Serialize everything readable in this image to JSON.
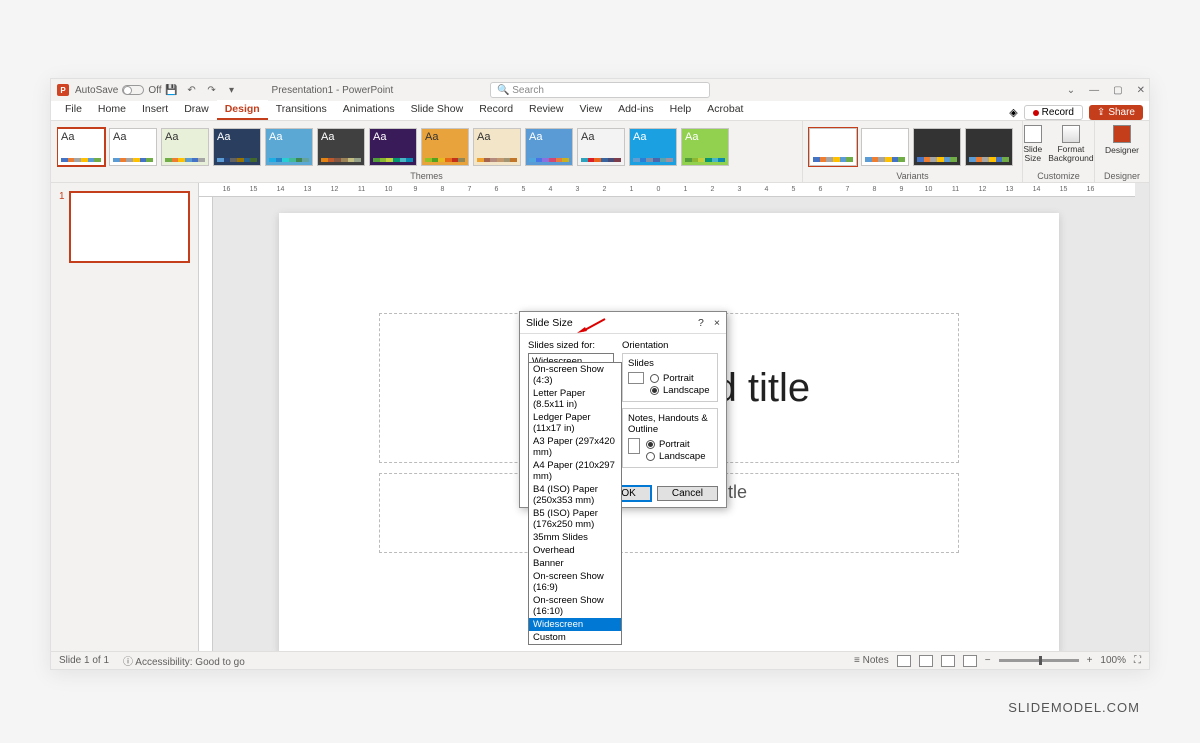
{
  "titlebar": {
    "autosave_label": "AutoSave",
    "autosave_state": "Off",
    "doc_title": "Presentation1 - PowerPoint",
    "search_placeholder": "Search"
  },
  "menu": {
    "tabs": [
      "File",
      "Home",
      "Insert",
      "Draw",
      "Design",
      "Transitions",
      "Animations",
      "Slide Show",
      "Record",
      "Review",
      "View",
      "Add-ins",
      "Help",
      "Acrobat"
    ],
    "active": "Design",
    "record_btn": "Record",
    "share_btn": "Share"
  },
  "ribbon": {
    "themes_label": "Themes",
    "variants_label": "Variants",
    "customize_label": "Customize",
    "designer_label": "Designer",
    "slide_size_btn": "Slide\nSize",
    "format_bg_btn": "Format\nBackground",
    "designer_btn": "Designer",
    "theme_colors": [
      [
        "#4472c4",
        "#ed7d31",
        "#a5a5a5",
        "#ffc000",
        "#5b9bd5",
        "#70ad47"
      ],
      [
        "#5b9bd5",
        "#ed7d31",
        "#a5a5a5",
        "#ffc000",
        "#4472c4",
        "#70ad47"
      ],
      [
        "#70ad47",
        "#ed7d31",
        "#ffc000",
        "#5b9bd5",
        "#4472c4",
        "#a5a5a5"
      ],
      [
        "#5b9bd5",
        "#264478",
        "#636363",
        "#997300",
        "#255e91",
        "#43682b"
      ],
      [
        "#1cade4",
        "#2683c6",
        "#27ced7",
        "#42ba97",
        "#3e8853",
        "#62a39f"
      ],
      [
        "#e48312",
        "#bd582c",
        "#865640",
        "#9b8357",
        "#c2bc80",
        "#94a088"
      ],
      [
        "#549e39",
        "#8ab833",
        "#c0cf3a",
        "#029676",
        "#4ab5c4",
        "#0989b1"
      ],
      [
        "#90c226",
        "#54a021",
        "#e6b91e",
        "#e76618",
        "#c42f1a",
        "#918655"
      ],
      [
        "#f0a22e",
        "#a5644e",
        "#b58b80",
        "#c3986d",
        "#a19574",
        "#c17529"
      ],
      [
        "#4ea6dc",
        "#4775e7",
        "#8971e1",
        "#d54773",
        "#e87b3e",
        "#c9b01f"
      ],
      [
        "#2da2bf",
        "#da1f28",
        "#eb641b",
        "#39639d",
        "#474b78",
        "#7d3c4a"
      ],
      [
        "#629dd1",
        "#297fd5",
        "#7f8fa9",
        "#4a66ac",
        "#5aa2ae",
        "#9d90a0"
      ],
      [
        "#549e39",
        "#8ab833",
        "#c0cf3a",
        "#029676",
        "#4ab5c4",
        "#0989b1"
      ]
    ],
    "theme_bg": [
      "#fff",
      "#fff",
      "#e8f0da",
      "#2a3f5f",
      "#5ba8d4",
      "#404040",
      "#3a1b5a",
      "#e8a33d",
      "#f3e6c8",
      "#5b9bd5",
      "#f3f3f3",
      "#1ba1e2",
      "#92d050"
    ],
    "theme_text_color": [
      "#333",
      "#333",
      "#333",
      "#fff",
      "#fff",
      "#fff",
      "#fff",
      "#333",
      "#333",
      "#fff",
      "#333",
      "#fff",
      "#fff"
    ],
    "variant_bg": [
      "#fff",
      "#fff",
      "#333",
      "#333"
    ],
    "variant_colors": [
      [
        "#4472c4",
        "#ed7d31",
        "#a5a5a5",
        "#ffc000",
        "#5b9bd5",
        "#70ad47"
      ],
      [
        "#5b9bd5",
        "#ed7d31",
        "#a5a5a5",
        "#ffc000",
        "#4472c4",
        "#70ad47"
      ],
      [
        "#4472c4",
        "#ed7d31",
        "#a5a5a5",
        "#ffc000",
        "#5b9bd5",
        "#70ad47"
      ],
      [
        "#5b9bd5",
        "#ed7d31",
        "#a5a5a5",
        "#ffc000",
        "#4472c4",
        "#70ad47"
      ]
    ]
  },
  "ruler_ticks": [
    "16",
    "15",
    "14",
    "13",
    "12",
    "11",
    "10",
    "9",
    "8",
    "7",
    "6",
    "5",
    "4",
    "3",
    "2",
    "1",
    "0",
    "1",
    "2",
    "3",
    "4",
    "5",
    "6",
    "7",
    "8",
    "9",
    "10",
    "11",
    "12",
    "13",
    "14",
    "15",
    "16"
  ],
  "slide": {
    "number": "1",
    "title_placeholder": "Click to add title",
    "subtitle_placeholder": "Click to add subtitle"
  },
  "dialog": {
    "title": "Slide Size",
    "help": "?",
    "close": "×",
    "sized_for_label": "Slides sized for:",
    "sized_for_value": "Widescreen",
    "options": [
      "On-screen Show (4:3)",
      "Letter Paper (8.5x11 in)",
      "Ledger Paper (11x17 in)",
      "A3 Paper (297x420 mm)",
      "A4 Paper (210x297 mm)",
      "B4 (ISO) Paper (250x353 mm)",
      "B5 (ISO) Paper (176x250 mm)",
      "35mm Slides",
      "Overhead",
      "Banner",
      "On-screen Show (16:9)",
      "On-screen Show (16:10)",
      "Widescreen",
      "Custom"
    ],
    "orientation_label": "Orientation",
    "slides_label": "Slides",
    "portrait": "Portrait",
    "landscape": "Landscape",
    "notes_label": "Notes, Handouts & Outline",
    "ok": "OK",
    "cancel": "Cancel"
  },
  "statusbar": {
    "slide_info": "Slide 1 of 1",
    "accessibility": "Accessibility: Good to go",
    "notes_btn": "Notes",
    "zoom": "100%"
  },
  "watermark": "SLIDEMODEL.COM"
}
